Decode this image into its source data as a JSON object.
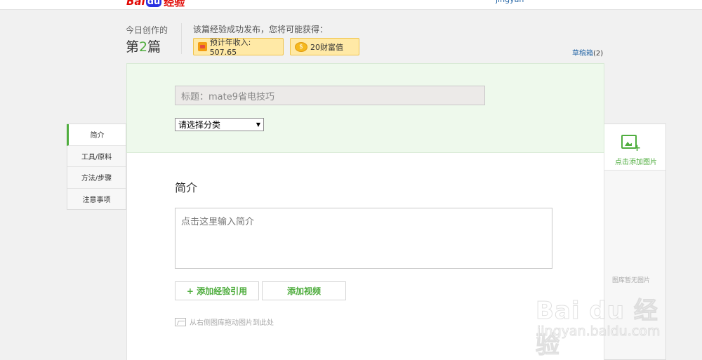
{
  "header": {
    "logo": {
      "bai": "Bai",
      "du": "du",
      "jingyan": "经验"
    },
    "user": "jingyan"
  },
  "stats": {
    "today_label": "今日创作的",
    "count_prefix": "第",
    "count_number": "2",
    "count_suffix": "篇",
    "reward_text": "该篇经验成功发布，您将可能获得：",
    "income_label": "预计年收入: 507.65",
    "wealth_label": "20财富值"
  },
  "drafts": {
    "label": "草稿箱",
    "count": "(2)"
  },
  "form": {
    "title_value": "标题：mate9省电技巧",
    "category_selected": "请选择分类",
    "section_title": "简介",
    "intro_placeholder": "点击这里输入简介",
    "add_quote_label": "+ 添加经验引用",
    "add_video_label": "添加视频",
    "drag_hint": "从右侧图库拖动图片到此处"
  },
  "side_nav": {
    "items": [
      {
        "label": "简介",
        "active": true
      },
      {
        "label": "工具/原料",
        "active": false
      },
      {
        "label": "方法/步骤",
        "active": false
      },
      {
        "label": "注意事项",
        "active": false
      }
    ]
  },
  "gallery": {
    "add_label": "点击添加图片",
    "empty_label": "图库暂无图片"
  },
  "watermark": {
    "main": "Bai du 经验",
    "sub": "jingyan.baidu.com"
  },
  "colors": {
    "accent": "#4fad3e",
    "link": "#2b6aa8",
    "badge_bg": "#ffe9a6",
    "top_bg": "#eef9ec"
  }
}
